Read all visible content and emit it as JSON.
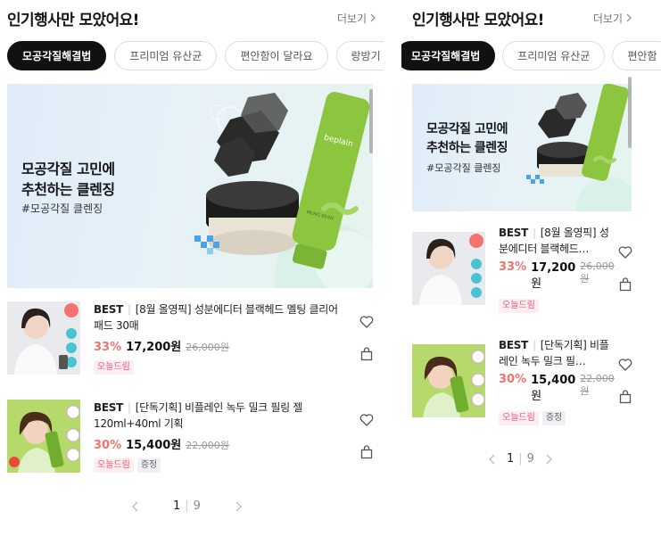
{
  "left": {
    "header": {
      "title": "인기행사만 모았어요!",
      "more_label": "더보기"
    },
    "chips": [
      "모공각질해결법",
      "프리미엄 유산균",
      "편안함이 달라요",
      "랑방기"
    ],
    "banner": {
      "line1": "모공각질 고민에",
      "line2": "추천하는 클렌징",
      "tag": "#모공각질 클렌징",
      "brand": "beplain",
      "product_label": "MUNG BEAN"
    },
    "products": [
      {
        "best": "BEST",
        "name": "[8월 올영픽] 성분에디터 블랙헤드 멜팅 클리어 패드 30매",
        "discount": "33%",
        "price": "17,200원",
        "original": "26,000원",
        "badges": [
          "오늘드림"
        ]
      },
      {
        "best": "BEST",
        "name": "[단독기획] 비플레인 녹두 밀크 필링 젤 120ml+40ml 기획",
        "discount": "30%",
        "price": "15,400원",
        "original": "22,000원",
        "badges": [
          "오늘드림",
          "증정"
        ]
      }
    ],
    "pagination": {
      "current": "1",
      "total": "9"
    }
  },
  "right": {
    "header": {
      "title": "인기행사만 모았어요!",
      "more_label": "더보기"
    },
    "chips": [
      "모공각질해결법",
      "프리미엄 유산균",
      "편안함"
    ],
    "banner": {
      "line1": "모공각질 고민에",
      "line2": "추천하는 클렌징",
      "tag": "#모공각질 클렌징"
    },
    "products": [
      {
        "best": "BEST",
        "name": "[8월 올영픽] 성분에디터 블랙헤드…",
        "discount": "33%",
        "price": "17,200",
        "won": "원",
        "original": "26,000",
        "original_won": "원",
        "badges": [
          "오늘드림"
        ]
      },
      {
        "best": "BEST",
        "name": "[단독기획] 비플레인 녹두 밀크 필…",
        "discount": "30%",
        "price": "15,400",
        "won": "원",
        "original": "22,000",
        "original_won": "원",
        "badges": [
          "오늘드림",
          "증정"
        ]
      }
    ],
    "pagination": {
      "current": "1",
      "total": "9"
    }
  },
  "icons": {
    "wish": "heart-icon",
    "cart": "shopping-bag-icon",
    "prev": "chevron-left-icon",
    "next": "chevron-right-icon",
    "more": "chevron-right-icon"
  },
  "colors": {
    "accent_discount": "#f27370",
    "badge_pink": "#f0567a",
    "chip_active": "#111111",
    "banner_bg": "#e3eef7",
    "product_green": "#8cc63f"
  }
}
